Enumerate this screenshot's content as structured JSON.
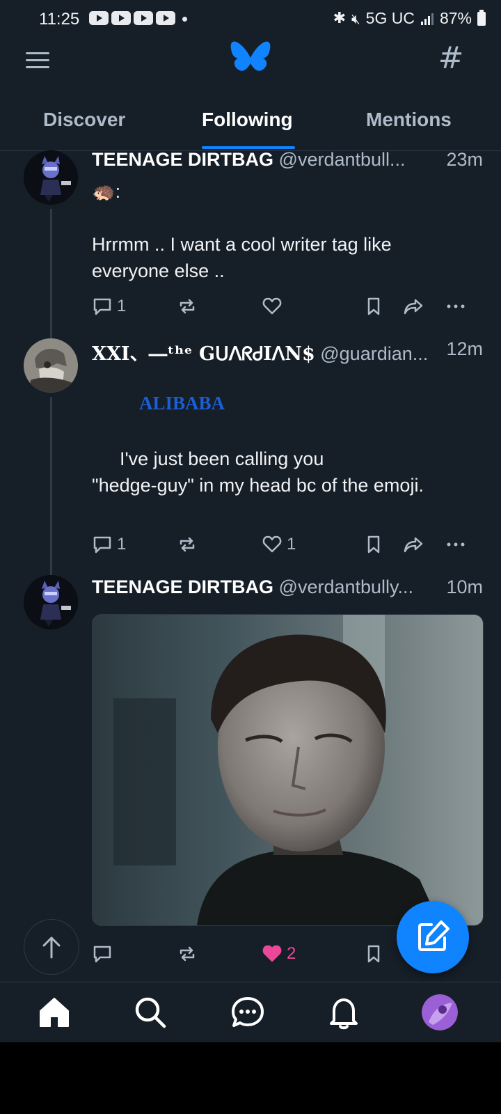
{
  "status_bar": {
    "time": "11:25",
    "network": "5G UC",
    "battery": "87%",
    "notification_icons": [
      "youtube-icon",
      "youtube-icon",
      "youtube-icon",
      "youtube-icon"
    ]
  },
  "top_bar": {
    "left_icon": "menu-icon",
    "logo": "butterfly-logo",
    "right_icon": "hashtag-icon"
  },
  "tabs": [
    {
      "label": "Discover",
      "active": false
    },
    {
      "label": "Following",
      "active": true
    },
    {
      "label": "Mentions",
      "active": false
    }
  ],
  "posts": [
    {
      "author_name": "TEENAGE DIRTBAG",
      "handle": "@verdantbull...",
      "time": "23m",
      "emoji_line": "🦔:",
      "text": "Hrrmm .. I want a cool writer tag like everyone else ..",
      "replies": "1",
      "reposts": "",
      "likes": "",
      "liked": false
    },
    {
      "author_name": "XXI、―ᵗʰᵉ GᑌᐱᖇᏧIᐱN$",
      "handle": "@guardian...",
      "time": "12m",
      "banner_text": "ALIBABA",
      "text_line1": "I've just been calling you",
      "text_line2": "\"hedge-guy\" in my head bc of the emoji.",
      "replies": "1",
      "reposts": "",
      "likes": "1",
      "liked": false
    },
    {
      "author_name": "TEENAGE DIRTBAG",
      "handle": "@verdantbully...",
      "time": "10m",
      "media": "gif-image",
      "replies": "",
      "reposts": "",
      "likes": "2",
      "liked": true
    }
  ],
  "bottom_nav": [
    {
      "icon": "home-icon",
      "active": true
    },
    {
      "icon": "search-icon",
      "active": false
    },
    {
      "icon": "chat-icon",
      "active": false
    },
    {
      "icon": "bell-icon",
      "active": false
    },
    {
      "icon": "profile-avatar",
      "active": false
    }
  ],
  "colors": {
    "background": "#161e27",
    "accent": "#1083fe",
    "muted": "#aebbc9",
    "like": "#ec4899",
    "banner": "#1a5fd6"
  }
}
